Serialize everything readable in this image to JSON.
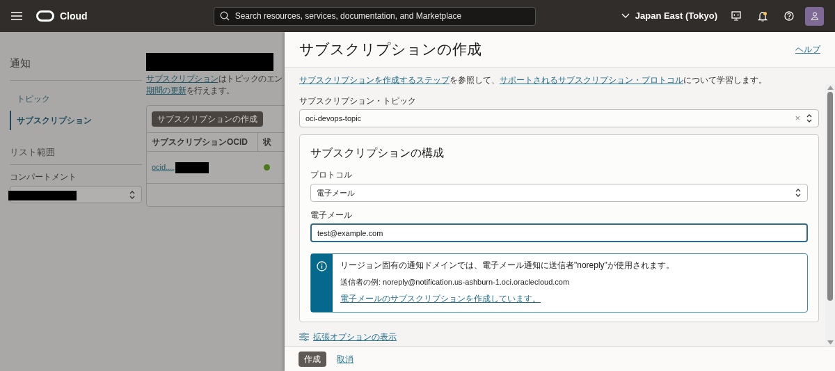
{
  "header": {
    "logo_text": "Cloud",
    "search": {
      "placeholder": "Search resources, services, documentation, and Marketplace"
    },
    "region": "Japan East (Tokyo)"
  },
  "sidebar": {
    "title": "通知",
    "items": [
      {
        "label": "トピック",
        "selected": false
      },
      {
        "label": "サブスクリプション",
        "selected": true
      }
    ],
    "scope_title": "リスト範囲",
    "compartment_label": "コンパートメント"
  },
  "main": {
    "lines": [
      [
        {
          "text": "サブスクリプション",
          "link": true
        },
        {
          "text": "はトピックのエン",
          "link": false
        }
      ],
      [
        {
          "text": "期間の更新",
          "link": true
        },
        {
          "text": "を行えます。",
          "link": false
        }
      ]
    ],
    "create_button": "サブスクリプションの作成",
    "table": {
      "columns": [
        "サブスクリプションOCID",
        "状"
      ],
      "rows": [
        {
          "ocid": "ocid....",
          "color": "#4a7a1e"
        }
      ]
    }
  },
  "panel": {
    "title": "サブスクリプションの作成",
    "help": "ヘルプ",
    "intro": [
      {
        "text": "サブスクリプションを作成するステップ",
        "link": true
      },
      {
        "text": "を参照して、",
        "link": false
      },
      {
        "text": "サポートされるサブスクリプション・プロトコル",
        "link": true
      },
      {
        "text": "について学習します。",
        "link": false
      }
    ],
    "topic_label": "サブスクリプション・トピック",
    "topic_value": "oci-devops-topic",
    "topic_clear": "×",
    "config_title": "サブスクリプションの構成",
    "protocol_label": "プロトコル",
    "protocol_value": "電子メール",
    "email_label": "電子メール",
    "email_value": "test@example.com",
    "info": {
      "line1": "リージョン固有の通知ドメインでは、電子メール通知に送信者\"noreply\"が使用されます。",
      "line2": "送信者の例: noreply@notification.us-ashburn-1.oci.oraclecloud.com",
      "link": "電子メールのサブスクリプションを作成しています。"
    },
    "advanced": "拡張オプションの表示",
    "create": "作成",
    "cancel": "取消"
  }
}
